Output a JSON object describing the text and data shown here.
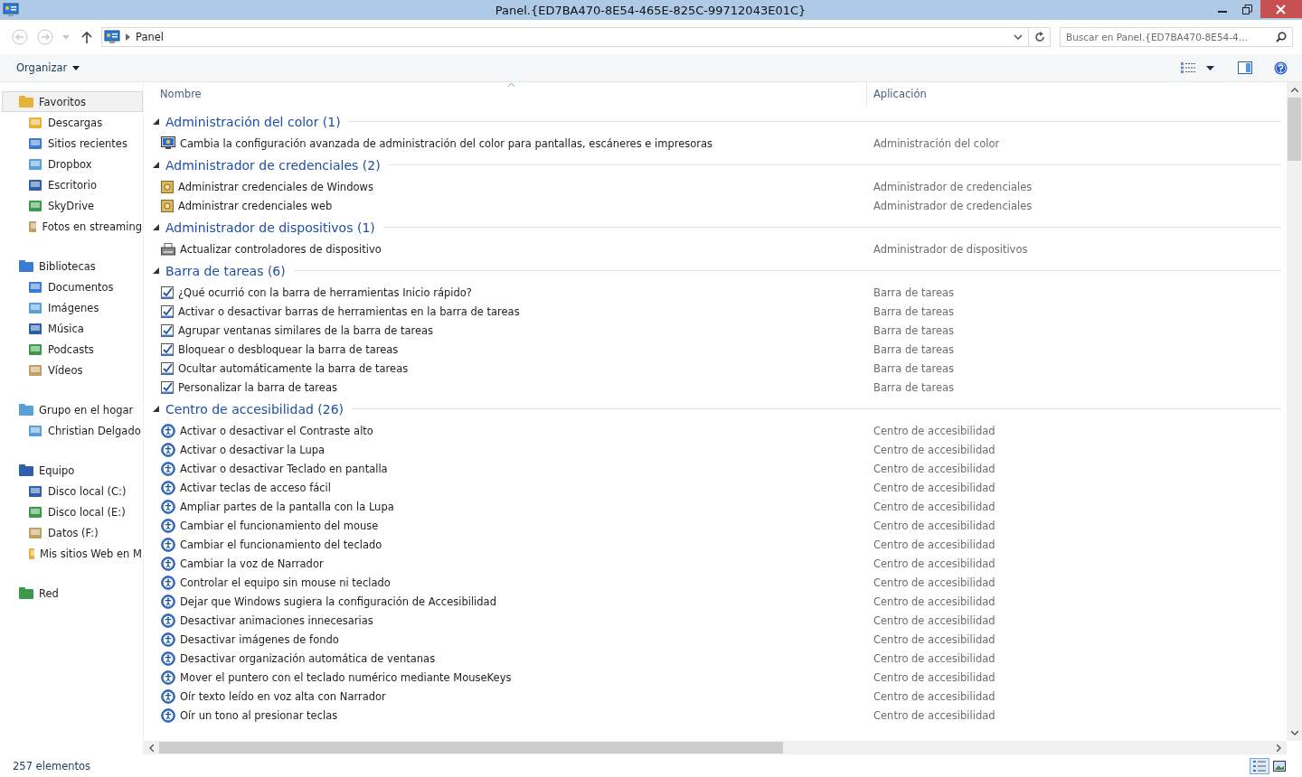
{
  "window": {
    "title": "Panel.{ED7BA470-8E54-465E-825C-99712043E01C}"
  },
  "address": {
    "crumb": "Panel",
    "search_placeholder": "Buscar en Panel.{ED7BA470-8E54-4..."
  },
  "toolbar": {
    "organize": "Organizar"
  },
  "sidebar": [
    {
      "label": "Favoritos",
      "selected": true,
      "children": [
        {
          "label": "Descargas",
          "selected": false
        },
        {
          "label": "Sitios recientes",
          "selected": false
        },
        {
          "label": "Dropbox",
          "selected": false
        },
        {
          "label": "Escritorio",
          "selected": false
        },
        {
          "label": "SkyDrive",
          "selected": false
        },
        {
          "label": "Fotos en streaming",
          "selected": false
        }
      ]
    },
    {
      "label": "Bibliotecas",
      "selected": false,
      "children": [
        {
          "label": "Documentos",
          "selected": false
        },
        {
          "label": "Imágenes",
          "selected": false
        },
        {
          "label": "Música",
          "selected": false
        },
        {
          "label": "Podcasts",
          "selected": false
        },
        {
          "label": "Vídeos",
          "selected": false
        }
      ]
    },
    {
      "label": "Grupo en el hogar",
      "selected": false,
      "children": [
        {
          "label": "Christian Delgado",
          "selected": false
        }
      ]
    },
    {
      "label": "Equipo",
      "selected": false,
      "children": [
        {
          "label": "Disco local (C:)",
          "selected": false
        },
        {
          "label": "Disco local (E:)",
          "selected": false
        },
        {
          "label": "Datos (F:)",
          "selected": false
        },
        {
          "label": "Mis sitios Web en M",
          "selected": false
        }
      ]
    },
    {
      "label": "Red",
      "selected": false
    }
  ],
  "columns": [
    "Nombre",
    "Aplicación"
  ],
  "groups": [
    {
      "title": "Administración del color (1)",
      "expanded": true,
      "items": [
        {
          "name": "Cambia la configuración avanzada de administración del color para pantallas, escáneres e impresoras",
          "app": "Administración del color"
        }
      ]
    },
    {
      "title": "Administrador de credenciales (2)",
      "expanded": true,
      "items": [
        {
          "name": "Administrar credenciales de Windows",
          "app": "Administrador de credenciales"
        },
        {
          "name": "Administrar credenciales web",
          "app": "Administrador de credenciales"
        }
      ]
    },
    {
      "title": "Administrador de dispositivos (1)",
      "expanded": true,
      "items": [
        {
          "name": "Actualizar controladores de dispositivo",
          "app": "Administrador de dispositivos"
        }
      ]
    },
    {
      "title": "Barra de tareas (6)",
      "expanded": true,
      "items": [
        {
          "name": "¿Qué ocurrió con la barra de herramientas Inicio rápido?",
          "app": "Barra de tareas"
        },
        {
          "name": "Activar o desactivar barras de herramientas en la barra de tareas",
          "app": "Barra de tareas"
        },
        {
          "name": "Agrupar ventanas similares de la barra de tareas",
          "app": "Barra de tareas"
        },
        {
          "name": "Bloquear o desbloquear la barra de tareas",
          "app": "Barra de tareas"
        },
        {
          "name": "Ocultar automáticamente la barra de tareas",
          "app": "Barra de tareas"
        },
        {
          "name": "Personalizar la barra de tareas",
          "app": "Barra de tareas"
        }
      ]
    },
    {
      "title": "Centro de accesibilidad (26)",
      "expanded": true,
      "items": [
        {
          "name": "Activar o desactivar el Contraste alto",
          "app": "Centro de accesibilidad"
        },
        {
          "name": "Activar o desactivar la Lupa",
          "app": "Centro de accesibilidad"
        },
        {
          "name": "Activar o desactivar Teclado en pantalla",
          "app": "Centro de accesibilidad"
        },
        {
          "name": "Activar teclas de acceso fácil",
          "app": "Centro de accesibilidad"
        },
        {
          "name": "Ampliar partes de la pantalla con la Lupa",
          "app": "Centro de accesibilidad"
        },
        {
          "name": "Cambiar el funcionamiento del mouse",
          "app": "Centro de accesibilidad"
        },
        {
          "name": "Cambiar el funcionamiento del teclado",
          "app": "Centro de accesibilidad"
        },
        {
          "name": "Cambiar la voz de Narrador",
          "app": "Centro de accesibilidad"
        },
        {
          "name": "Controlar el equipo sin mouse ni teclado",
          "app": "Centro de accesibilidad"
        },
        {
          "name": "Dejar que Windows sugiera la configuración de Accesibilidad",
          "app": "Centro de accesibilidad"
        },
        {
          "name": "Desactivar animaciones innecesarias",
          "app": "Centro de accesibilidad"
        },
        {
          "name": "Desactivar imágenes de fondo",
          "app": "Centro de accesibilidad"
        },
        {
          "name": "Desactivar organización automática de ventanas",
          "app": "Centro de accesibilidad"
        },
        {
          "name": "Mover el puntero con el teclado numérico mediante MouseKeys",
          "app": "Centro de accesibilidad"
        },
        {
          "name": "Oír texto leído en voz alta con Narrador",
          "app": "Centro de accesibilidad"
        },
        {
          "name": "Oír un tono al presionar teclas",
          "app": "Centro de accesibilidad"
        }
      ]
    }
  ],
  "status_bar": {
    "count": "257 elementos"
  }
}
